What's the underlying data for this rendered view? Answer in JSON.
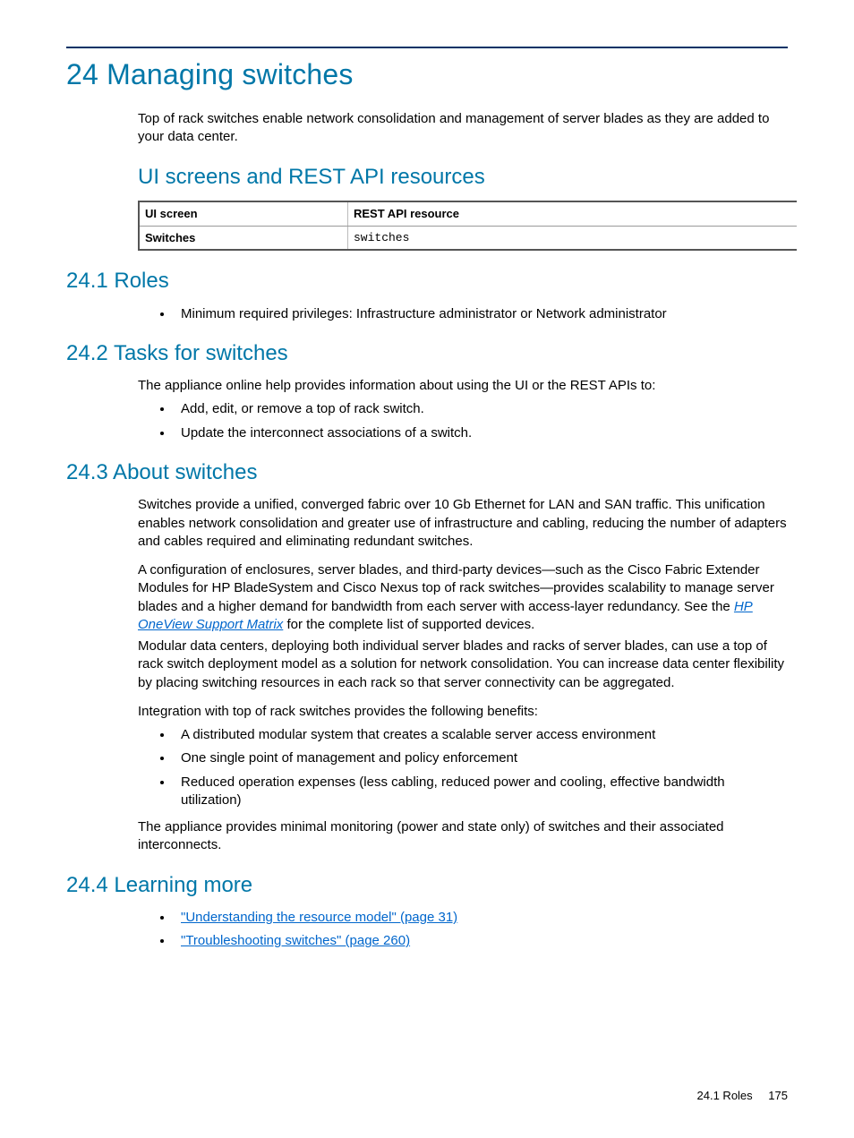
{
  "chapter": {
    "title": "24 Managing switches",
    "intro": "Top of rack switches enable network consolidation and management of server blades as they are added to your data center."
  },
  "ui_section": {
    "heading": "UI screens and REST API resources",
    "table": {
      "col1_header": "UI screen",
      "col2_header": "REST API resource",
      "row1_col1": "Switches",
      "row1_col2": "switches"
    }
  },
  "roles": {
    "heading": "24.1 Roles",
    "bullets": [
      "Minimum required privileges: Infrastructure administrator or Network administrator"
    ]
  },
  "tasks": {
    "heading": "24.2 Tasks for switches",
    "intro": "The appliance online help provides information about using the UI or the REST APIs to:",
    "bullets": [
      "Add, edit, or remove a top of rack switch.",
      "Update the interconnect associations of a switch."
    ]
  },
  "about": {
    "heading": "24.3 About switches",
    "p1": "Switches provide a unified, converged fabric over 10 Gb Ethernet for LAN and SAN traffic. This unification enables network consolidation and greater use of infrastructure and cabling, reducing the number of adapters and cables required and eliminating redundant switches.",
    "p2_a": "A configuration of enclosures, server blades, and third-party devices—such as the Cisco Fabric Extender Modules for HP BladeSystem and Cisco Nexus top of rack switches—provides scalability to manage server blades and a higher demand for bandwidth from each server with access-layer redundancy. See the ",
    "p2_link": "HP OneView Support Matrix",
    "p2_b": " for the complete list of supported devices.",
    "p3": "Modular data centers, deploying both individual server blades and racks of server blades, can use a top of rack switch deployment model as a solution for network consolidation. You can increase data center flexibility by placing switching resources in each rack so that server connectivity can be aggregated.",
    "p4": "Integration with top of rack switches provides the following benefits:",
    "bullets": [
      "A distributed modular system that creates a scalable server access environment",
      "One single point of management and policy enforcement",
      "Reduced operation expenses (less cabling, reduced power and cooling, effective bandwidth utilization)"
    ],
    "p5": "The appliance provides minimal monitoring (power and state only) of switches and their associated interconnects."
  },
  "learning": {
    "heading": "24.4 Learning more",
    "bullets": [
      "\"Understanding the resource model\" (page 31)",
      "\"Troubleshooting switches\" (page 260)"
    ]
  },
  "footer": {
    "section": "24.1 Roles",
    "page": "175"
  }
}
